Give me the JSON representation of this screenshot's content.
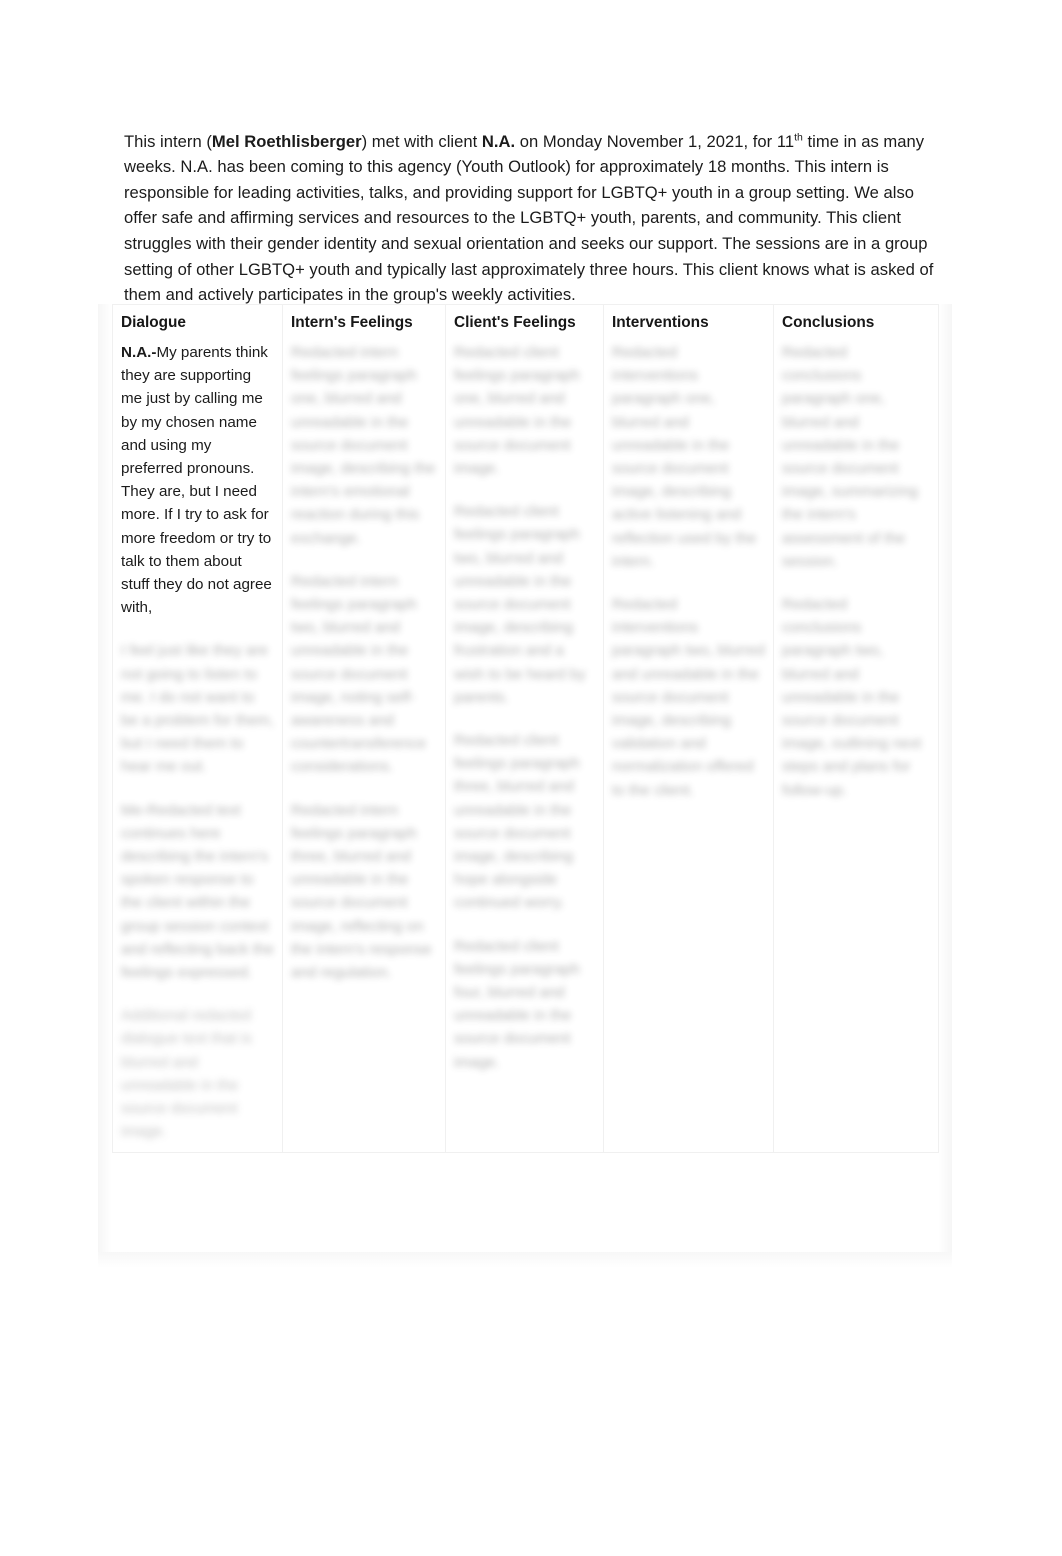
{
  "document": {
    "intro": {
      "seg1": "This intern (",
      "intern_name": "Mel Roethlisberger",
      "seg2": ") met with client ",
      "client_initials": "N.A.",
      "seg3": " on Monday November 1, 2021, for 11",
      "ordinal_suffix": "th",
      "seg4": " time in as many weeks. N.A. has been coming to this agency (Youth Outlook) for approximately 18 months. This intern is responsible for leading activities, talks, and providing support for LGBTQ+ youth in a group setting. We also offer safe and affirming services and resources to the LGBTQ+ youth, parents, and community. This client struggles with their gender identity and sexual orientation and seeks our support. The sessions are in a group setting of other LGBTQ+ youth and typically last approximately three hours. This client knows what is asked of them and actively participates in the group's weekly activities."
    },
    "table": {
      "headers": [
        "Dialogue",
        "Intern's Feelings",
        "Client's Feelings",
        "Interventions",
        "Conclusions"
      ],
      "rows": [
        {
          "dialogue": {
            "speaker": "N.A.-",
            "visible_text": "My parents think they are supporting me just by calling me by my chosen name and using my preferred pronouns. They are, but I need more. If I try to ask for more freedom or try to talk to them about stuff they do not agree with,",
            "redacted_paragraphs": [
              "I feel just like they are not going to listen to me. I do not want to be a problem for them, but I need them to hear me out.",
              "Me-Redacted text continues here describing the intern's spoken response to the client within the group session context and reflecting back the feelings expressed.",
              "Additional redacted dialogue text that is blurred and unreadable in the source document image."
            ]
          },
          "intern_feelings": {
            "redacted_paragraphs": [
              "Redacted intern feelings paragraph one, blurred and unreadable in the source document image, describing the intern's emotional reaction during this exchange.",
              "Redacted intern feelings paragraph two, blurred and unreadable in the source document image, noting self-awareness and countertransference considerations.",
              "Redacted intern feelings paragraph three, blurred and unreadable in the source document image, reflecting on the intern's response and regulation."
            ]
          },
          "client_feelings": {
            "redacted_paragraphs": [
              "Redacted client feelings paragraph one, blurred and unreadable in the source document image.",
              "Redacted client feelings paragraph two, blurred and unreadable in the source document image, describing frustration and a wish to be heard by parents.",
              "Redacted client feelings paragraph three, blurred and unreadable in the source document image, describing hope alongside continued worry.",
              "Redacted client feelings paragraph four, blurred and unreadable in the source document image."
            ]
          },
          "interventions": {
            "redacted_paragraphs": [
              "Redacted interventions paragraph one, blurred and unreadable in the source document image, describing active listening and reflection used by the intern.",
              "Redacted interventions paragraph two, blurred and unreadable in the source document image, describing validation and normalization offered to the client."
            ]
          },
          "conclusions": {
            "redacted_paragraphs": [
              "Redacted conclusions paragraph one, blurred and unreadable in the source document image, summarizing the intern's assessment of the session.",
              "Redacted conclusions paragraph two, blurred and unreadable in the source document image, outlining next steps and plans for follow-up."
            ]
          }
        }
      ]
    }
  }
}
